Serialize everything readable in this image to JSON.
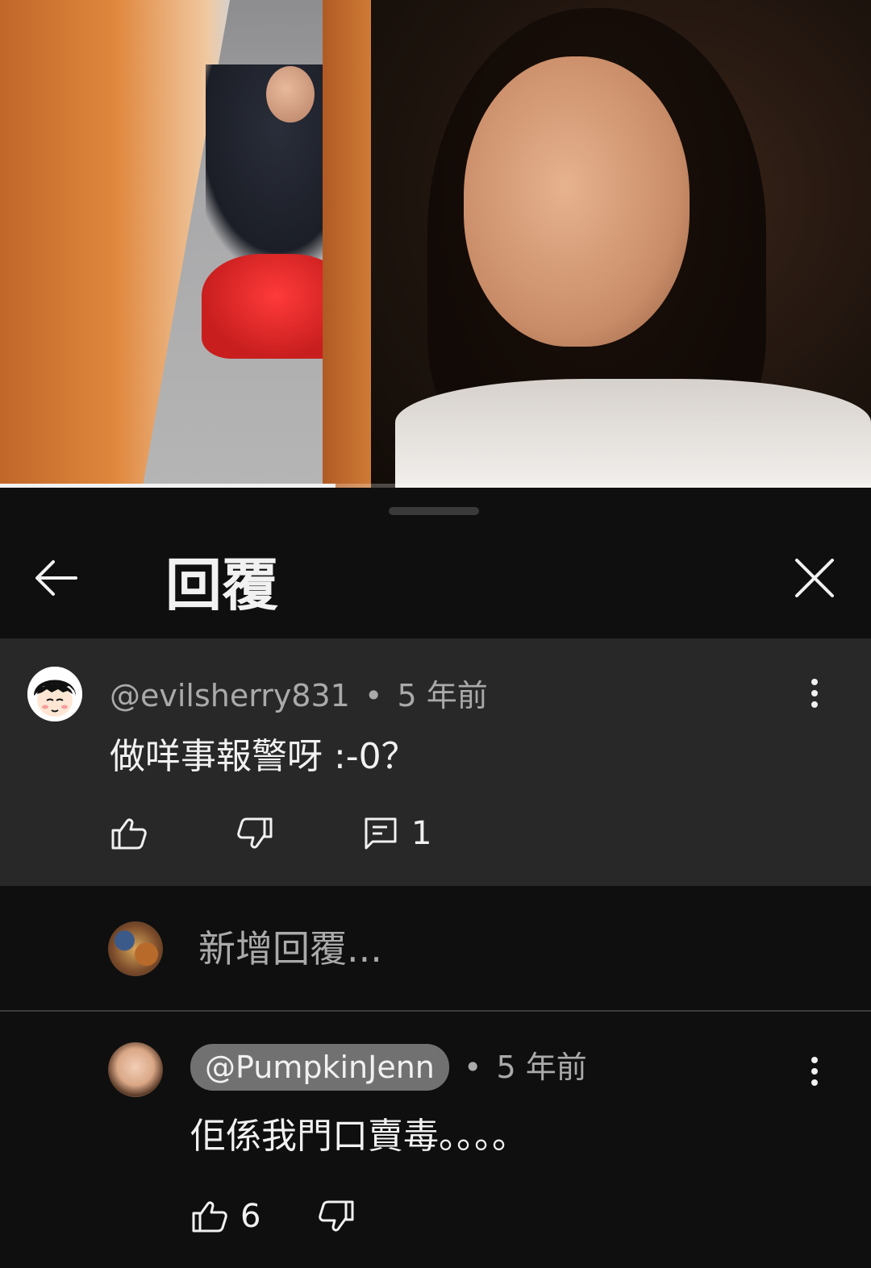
{
  "video": {
    "progress_fraction": 0.385
  },
  "sheet": {
    "title": "回覆"
  },
  "parent_comment": {
    "author": "@evilsherry831",
    "separator": "•",
    "time": "5 年前",
    "text": "做咩事報警呀 :-0？",
    "reply_count": "1"
  },
  "reply_input": {
    "placeholder": "新增回覆..."
  },
  "reply": {
    "author": "@PumpkinJenn",
    "separator": "•",
    "time": "5 年前",
    "text": "佢係我門口賣毒。。。。",
    "like_count": "6"
  },
  "icons": {
    "back": "arrow-left-icon",
    "close": "close-icon",
    "more": "more-vert-icon",
    "like": "thumb-up-icon",
    "dislike": "thumb-down-icon",
    "reply": "comment-icon"
  },
  "colors": {
    "background": "#0f0f0f",
    "highlighted_comment": "#282828",
    "mention_chip": "#717171",
    "secondary_text": "#aaaaaa"
  }
}
